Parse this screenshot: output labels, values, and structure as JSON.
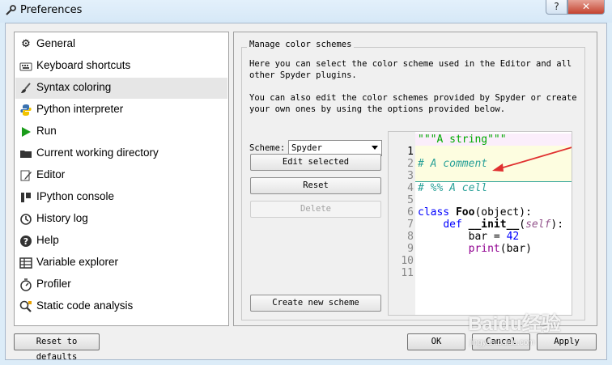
{
  "window": {
    "title": "Preferences",
    "help_label": "?",
    "close_label": "✕"
  },
  "sidebar": {
    "items": [
      {
        "label": "General",
        "icon": "gears-icon"
      },
      {
        "label": "Keyboard shortcuts",
        "icon": "keyboard-icon"
      },
      {
        "label": "Syntax coloring",
        "icon": "brush-icon",
        "selected": true
      },
      {
        "label": "Python interpreter",
        "icon": "python-icon"
      },
      {
        "label": "Run",
        "icon": "play-icon"
      },
      {
        "label": "Current working directory",
        "icon": "folder-icon"
      },
      {
        "label": "Editor",
        "icon": "edit-icon"
      },
      {
        "label": "IPython console",
        "icon": "ipython-icon"
      },
      {
        "label": "History log",
        "icon": "history-icon"
      },
      {
        "label": "Help",
        "icon": "help-icon"
      },
      {
        "label": "Variable explorer",
        "icon": "table-icon"
      },
      {
        "label": "Profiler",
        "icon": "profiler-icon"
      },
      {
        "label": "Static code analysis",
        "icon": "analysis-icon"
      }
    ]
  },
  "panel": {
    "group_title": "Manage color schemes",
    "desc1_line1": "Here you can select the color scheme used in the Editor and all",
    "desc1_line2": "other Spyder plugins.",
    "desc2_line1": "You can also edit the color schemes provided by Spyder or create",
    "desc2_line2": "your own ones by using the options provided below.",
    "scheme_label": "Scheme:",
    "scheme_value": "Spyder",
    "edit_selected": "Edit selected",
    "reset": "Reset",
    "delete": "Delete",
    "create_new": "Create new scheme"
  },
  "preview": {
    "line_numbers": [
      "1",
      "2",
      "3",
      "4",
      "5",
      "6",
      "7",
      "8",
      "9",
      "10",
      "11"
    ],
    "l1": "\"\"\"A string\"\"\"",
    "l3": "# A comment",
    "l5": "# %% A cell",
    "l7_kw": "class",
    "l7_name": "Foo",
    "l7_rest": "(object):",
    "l8_indent": "    ",
    "l8_kw": "def",
    "l8_name": "__init__",
    "l8_self": "self",
    "l8_open": "(",
    "l8_close": "):",
    "l9_indent": "        ",
    "l9_text": "bar = ",
    "l9_num": "42",
    "l10_indent": "        ",
    "l10_builtin": "print",
    "l10_rest": "(bar)",
    "colors": {
      "string": "#00aa00",
      "comment": "#2aa198",
      "keyword": "#0000ff",
      "builtin": "#900090",
      "cell_bg": "#fdfde0",
      "line1_bg": "#fbeefb"
    }
  },
  "footer": {
    "reset_defaults": "Reset to defaults",
    "ok": "OK",
    "cancel": "Cancel",
    "apply": "Apply"
  },
  "watermark": {
    "text": "Baidu经验",
    "sub": "jingyan.baidu.com"
  }
}
